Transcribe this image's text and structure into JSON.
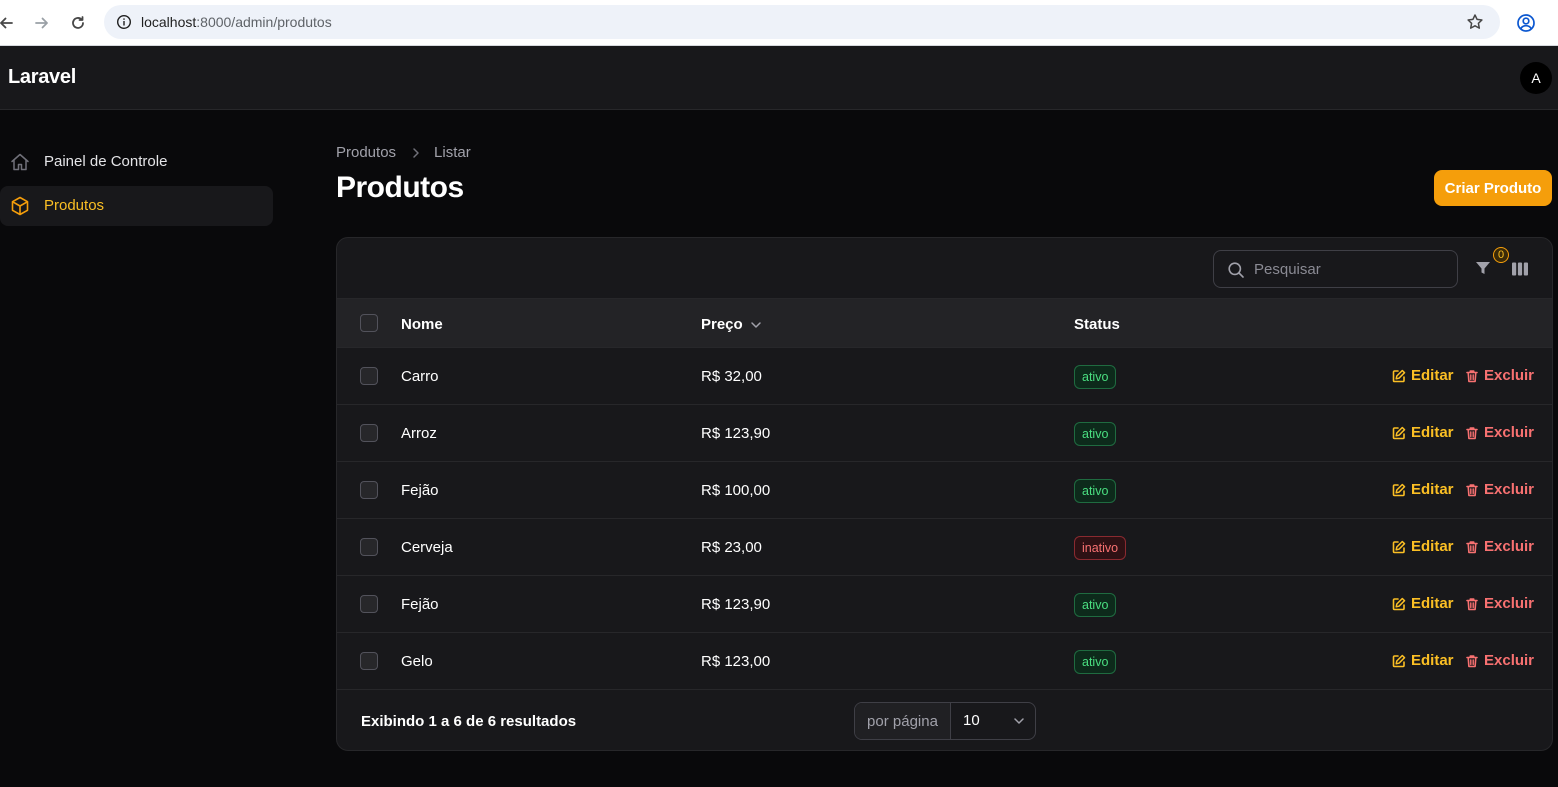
{
  "browser": {
    "url_host": "localhost",
    "url_rest": ":8000/admin/produtos"
  },
  "app": {
    "brand": "Laravel",
    "avatar_initial": "A"
  },
  "sidebar": {
    "items": [
      {
        "label": "Painel de Controle",
        "icon": "home-icon",
        "active": false
      },
      {
        "label": "Produtos",
        "icon": "cube-icon",
        "active": true
      }
    ]
  },
  "header": {
    "breadcrumb": [
      "Produtos",
      "Listar"
    ],
    "title": "Produtos",
    "create_button": "Criar Produto"
  },
  "table": {
    "search_placeholder": "Pesquisar",
    "filter_count": "0",
    "columns": {
      "name": "Nome",
      "price": "Preço",
      "status": "Status"
    },
    "rows": [
      {
        "name": "Carro",
        "price": "R$ 32,00",
        "status": "ativo",
        "edit": "Editar",
        "delete": "Excluir"
      },
      {
        "name": "Arroz",
        "price": "R$ 123,90",
        "status": "ativo",
        "edit": "Editar",
        "delete": "Excluir"
      },
      {
        "name": "Fejão",
        "price": "R$ 100,00",
        "status": "ativo",
        "edit": "Editar",
        "delete": "Excluir"
      },
      {
        "name": "Cerveja",
        "price": "R$ 23,00",
        "status": "inativo",
        "edit": "Editar",
        "delete": "Excluir"
      },
      {
        "name": "Fejão",
        "price": "R$ 123,90",
        "status": "ativo",
        "edit": "Editar",
        "delete": "Excluir"
      },
      {
        "name": "Gelo",
        "price": "R$ 123,00",
        "status": "ativo",
        "edit": "Editar",
        "delete": "Excluir"
      }
    ],
    "footer": {
      "results_text": "Exibindo 1 a 6 de 6 resultados",
      "per_page_label": "por página",
      "per_page_value": "10"
    }
  },
  "colors": {
    "accent": "#f59e0b",
    "success": "#4ade80",
    "danger": "#f87171",
    "background": "#09090b",
    "surface": "#18181b"
  }
}
